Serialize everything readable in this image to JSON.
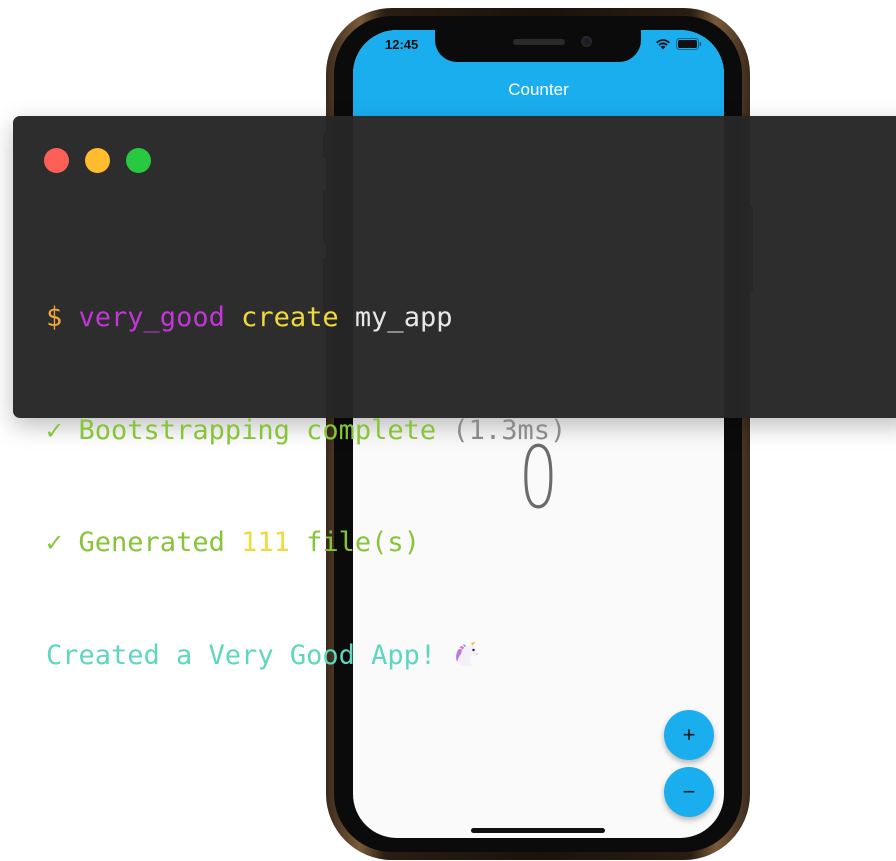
{
  "phone": {
    "status_time": "12:45",
    "app_title": "Counter",
    "counter_value": "0",
    "fab_increment_label": "+",
    "fab_decrement_label": "−",
    "accent_color": "#1aaeef"
  },
  "terminal": {
    "line1": {
      "prompt": "$",
      "tool": "very_good",
      "command": "create",
      "argument": "my_app"
    },
    "line2": {
      "check": "✓",
      "text": "Bootstrapping complete",
      "timing": "(1.3ms)"
    },
    "line3": {
      "check": "✓",
      "prefix": "Generated",
      "count": "111",
      "suffix": "file(s)"
    },
    "line4": {
      "text": "Created a Very Good App!",
      "icon": "unicorn-icon"
    },
    "colors": {
      "prompt": "#f0a838",
      "tool": "#c236d8",
      "command": "#f1d93b",
      "argument": "#e8e8e8",
      "success": "#86c43a",
      "muted": "#8a8a8a",
      "count": "#f1d93b",
      "final": "#5fd6c0"
    }
  }
}
